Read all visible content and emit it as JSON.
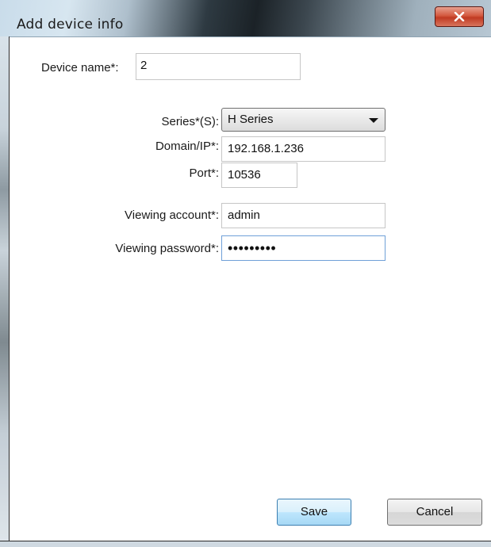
{
  "window": {
    "title": "Add device info",
    "close_glyph": "x"
  },
  "form": {
    "device_name": {
      "label": "Device name*:",
      "value": "2"
    },
    "series": {
      "label": "Series*(S):",
      "value": "H Series"
    },
    "domain_ip": {
      "label": "Domain/IP*:",
      "value": "192.168.1.236"
    },
    "port": {
      "label": "Port*:",
      "value": "10536"
    },
    "viewing_account": {
      "label": "Viewing account*:",
      "value": "admin"
    },
    "viewing_password": {
      "label": "Viewing password*:",
      "value": "•••••••••"
    }
  },
  "buttons": {
    "save": "Save",
    "cancel": "Cancel"
  },
  "colors": {
    "close_button": "#c03a22",
    "focus_border": "#6fa0d8",
    "default_button_border": "#3c7fb1"
  }
}
